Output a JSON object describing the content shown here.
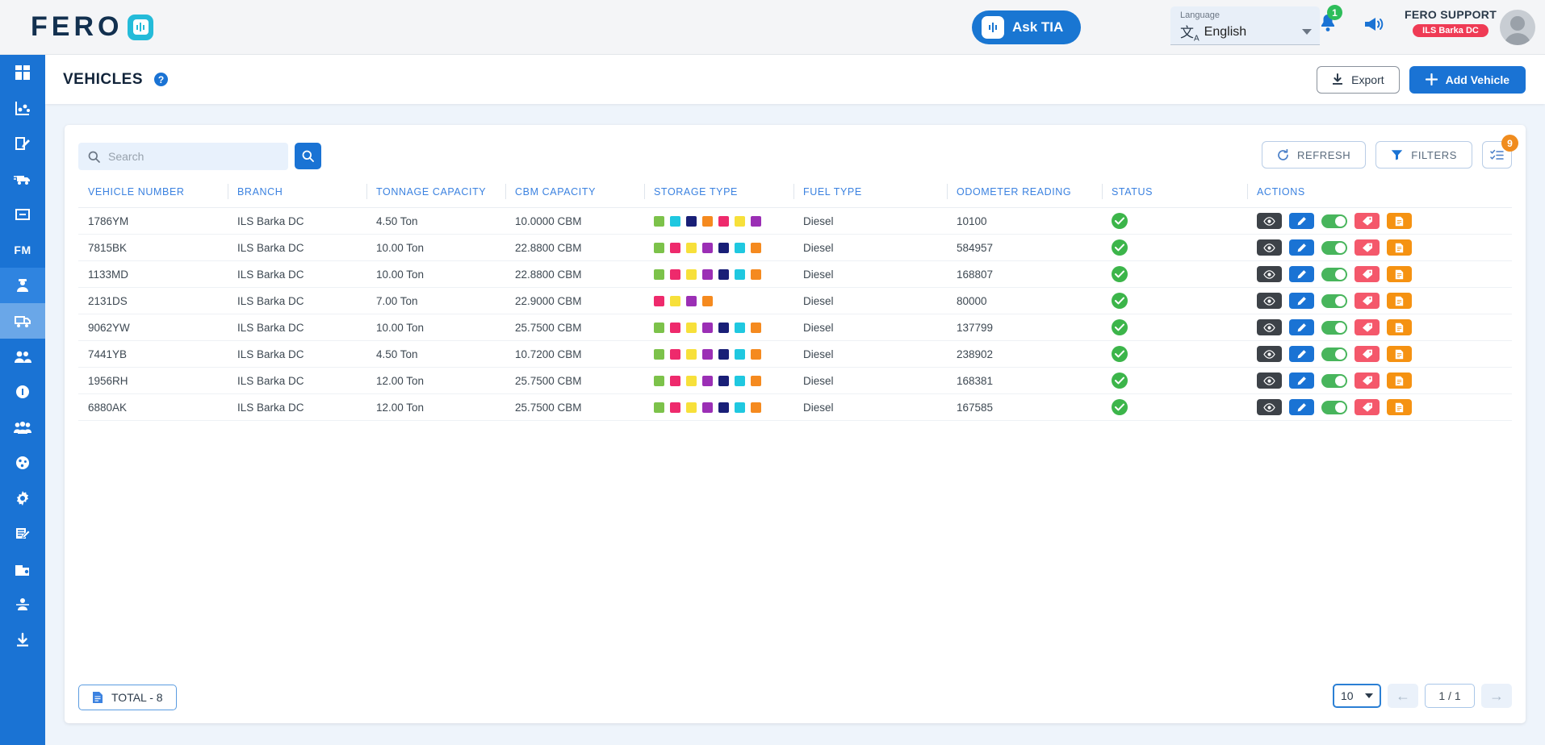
{
  "header": {
    "logo_text": "FERO",
    "ask_tia_label": "Ask TIA",
    "language_label": "Language",
    "language_value": "English",
    "notification_count": "1",
    "user_name": "FERO SUPPORT",
    "user_branch_badge": "ILS Barka DC"
  },
  "page": {
    "title": "VEHICLES",
    "help": "?",
    "export_label": "Export",
    "add_vehicle_label": "Add Vehicle"
  },
  "toolbar": {
    "search_placeholder": "Search",
    "search_value": "",
    "refresh_label": "REFRESH",
    "filters_label": "FILTERS",
    "columns_badge": "9"
  },
  "table": {
    "columns": [
      "VEHICLE NUMBER",
      "BRANCH",
      "TONNAGE CAPACITY",
      "CBM CAPACITY",
      "STORAGE TYPE",
      "FUEL TYPE",
      "ODOMETER READING",
      "STATUS",
      "ACTIONS"
    ],
    "rows": [
      {
        "vehicle_number": "1786YM",
        "branch": "ILS Barka DC",
        "tonnage_capacity": "4.50 Ton",
        "cbm_capacity": "10.0000 CBM",
        "storage_type_colors": [
          "#7cc24a",
          "#1fc8e0",
          "#191f77",
          "#f58a1f",
          "#ee2a6c",
          "#f7e03a",
          "#9b2fb5"
        ],
        "fuel_type": "Diesel",
        "odometer_reading": "10100",
        "status": "active"
      },
      {
        "vehicle_number": "7815BK",
        "branch": "ILS Barka DC",
        "tonnage_capacity": "10.00 Ton",
        "cbm_capacity": "22.8800 CBM",
        "storage_type_colors": [
          "#7cc24a",
          "#ee2a6c",
          "#f7e03a",
          "#9b2fb5",
          "#191f77",
          "#1fc8e0",
          "#f58a1f"
        ],
        "fuel_type": "Diesel",
        "odometer_reading": "584957",
        "status": "active"
      },
      {
        "vehicle_number": "1133MD",
        "branch": "ILS Barka DC",
        "tonnage_capacity": "10.00 Ton",
        "cbm_capacity": "22.8800 CBM",
        "storage_type_colors": [
          "#7cc24a",
          "#ee2a6c",
          "#f7e03a",
          "#9b2fb5",
          "#191f77",
          "#1fc8e0",
          "#f58a1f"
        ],
        "fuel_type": "Diesel",
        "odometer_reading": "168807",
        "status": "active"
      },
      {
        "vehicle_number": "2131DS",
        "branch": "ILS Barka DC",
        "tonnage_capacity": "7.00 Ton",
        "cbm_capacity": "22.9000 CBM",
        "storage_type_colors": [
          "#ee2a6c",
          "#f7e03a",
          "#9b2fb5",
          "#f58a1f"
        ],
        "fuel_type": "Diesel",
        "odometer_reading": "80000",
        "status": "active"
      },
      {
        "vehicle_number": "9062YW",
        "branch": "ILS Barka DC",
        "tonnage_capacity": "10.00 Ton",
        "cbm_capacity": "25.7500 CBM",
        "storage_type_colors": [
          "#7cc24a",
          "#ee2a6c",
          "#f7e03a",
          "#9b2fb5",
          "#191f77",
          "#1fc8e0",
          "#f58a1f"
        ],
        "fuel_type": "Diesel",
        "odometer_reading": "137799",
        "status": "active"
      },
      {
        "vehicle_number": "7441YB",
        "branch": "ILS Barka DC",
        "tonnage_capacity": "4.50 Ton",
        "cbm_capacity": "10.7200 CBM",
        "storage_type_colors": [
          "#7cc24a",
          "#ee2a6c",
          "#f7e03a",
          "#9b2fb5",
          "#191f77",
          "#1fc8e0",
          "#f58a1f"
        ],
        "fuel_type": "Diesel",
        "odometer_reading": "238902",
        "status": "active"
      },
      {
        "vehicle_number": "1956RH",
        "branch": "ILS Barka DC",
        "tonnage_capacity": "12.00 Ton",
        "cbm_capacity": "25.7500 CBM",
        "storage_type_colors": [
          "#7cc24a",
          "#ee2a6c",
          "#f7e03a",
          "#9b2fb5",
          "#191f77",
          "#1fc8e0",
          "#f58a1f"
        ],
        "fuel_type": "Diesel",
        "odometer_reading": "168381",
        "status": "active"
      },
      {
        "vehicle_number": "6880AK",
        "branch": "ILS Barka DC",
        "tonnage_capacity": "12.00 Ton",
        "cbm_capacity": "25.7500 CBM",
        "storage_type_colors": [
          "#7cc24a",
          "#ee2a6c",
          "#f7e03a",
          "#9b2fb5",
          "#191f77",
          "#1fc8e0",
          "#f58a1f"
        ],
        "fuel_type": "Diesel",
        "odometer_reading": "167585",
        "status": "active"
      }
    ]
  },
  "footer": {
    "total_label": "TOTAL  - 8",
    "page_size": "10",
    "page_info": "1 / 1"
  },
  "sidebar": {
    "items": [
      {
        "name": "dashboard",
        "icon": "dashboard-icon",
        "state": "normal"
      },
      {
        "name": "analytics",
        "icon": "analytics-icon",
        "state": "normal"
      },
      {
        "name": "orders",
        "icon": "clipboard-edit-icon",
        "state": "normal"
      },
      {
        "name": "shipments",
        "icon": "truck-fast-icon",
        "state": "normal"
      },
      {
        "name": "inventory",
        "icon": "box-icon",
        "state": "normal"
      },
      {
        "name": "fleet-management",
        "icon": "fm-text-icon",
        "state": "normal",
        "text": "FM"
      },
      {
        "name": "drivers",
        "icon": "driver-icon",
        "state": "sel-dark"
      },
      {
        "name": "vehicles",
        "icon": "vehicle-truck-icon",
        "state": "sel-light"
      },
      {
        "name": "customers",
        "icon": "users-icon",
        "state": "normal"
      },
      {
        "name": "information",
        "icon": "info-icon",
        "state": "normal"
      },
      {
        "name": "teams",
        "icon": "group-icon",
        "state": "normal"
      },
      {
        "name": "network",
        "icon": "globe-icon",
        "state": "normal"
      },
      {
        "name": "settings",
        "icon": "gear-icon",
        "state": "normal"
      },
      {
        "name": "reports",
        "icon": "note-edit-icon",
        "state": "normal"
      },
      {
        "name": "cases",
        "icon": "briefcase-icon",
        "state": "normal"
      },
      {
        "name": "organization",
        "icon": "org-chart-icon",
        "state": "normal"
      },
      {
        "name": "downloads",
        "icon": "download-icon",
        "state": "normal"
      }
    ]
  },
  "colors": {
    "primary": "#1a73d4",
    "header_text": "#3b82e0",
    "status_green": "#3cb54a",
    "badge_orange": "#f08c1e",
    "badge_red": "#ef3b55"
  }
}
